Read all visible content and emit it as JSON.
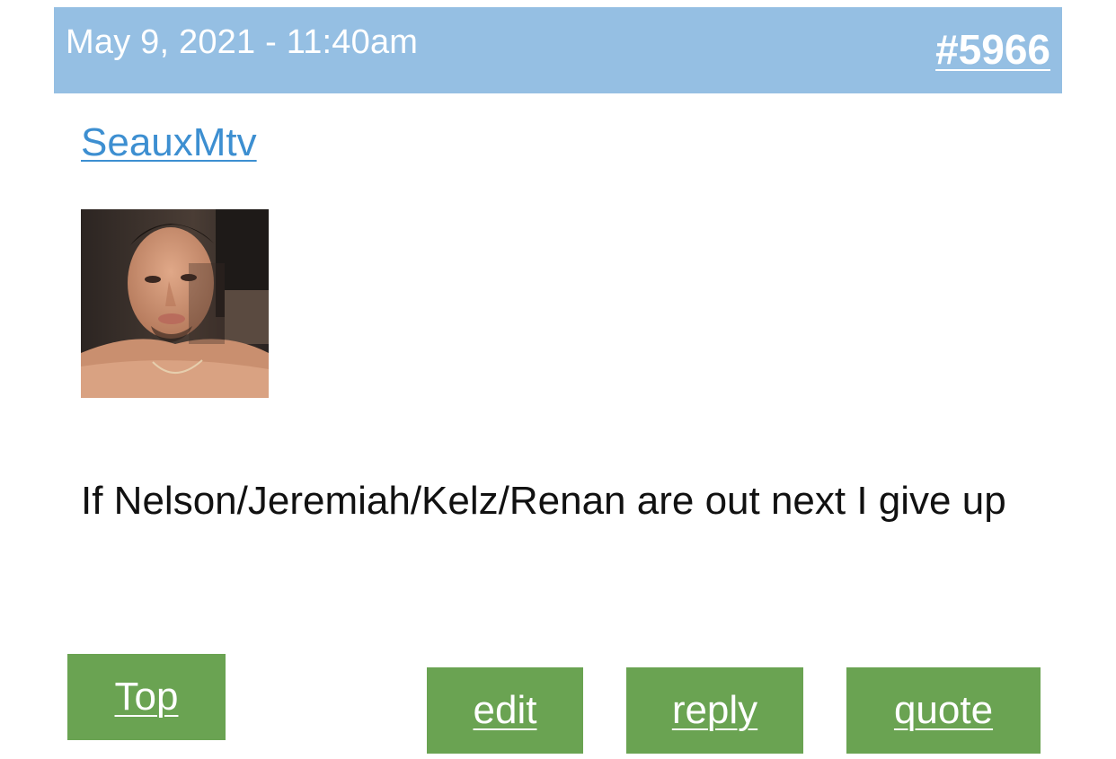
{
  "post": {
    "date": "May 9, 2021 - 11:40am",
    "number": "#5966",
    "author": "SeauxMtv",
    "body": "If Nelson/Jeremiah/Kelz/Renan are out next I give up"
  },
  "actions": {
    "top_label": "Top",
    "edit_label": "edit",
    "reply_label": "reply",
    "quote_label": "quote"
  },
  "colors": {
    "header_bg": "#95bfe3",
    "link": "#3d8fd1",
    "button_bg": "#6aa352"
  }
}
